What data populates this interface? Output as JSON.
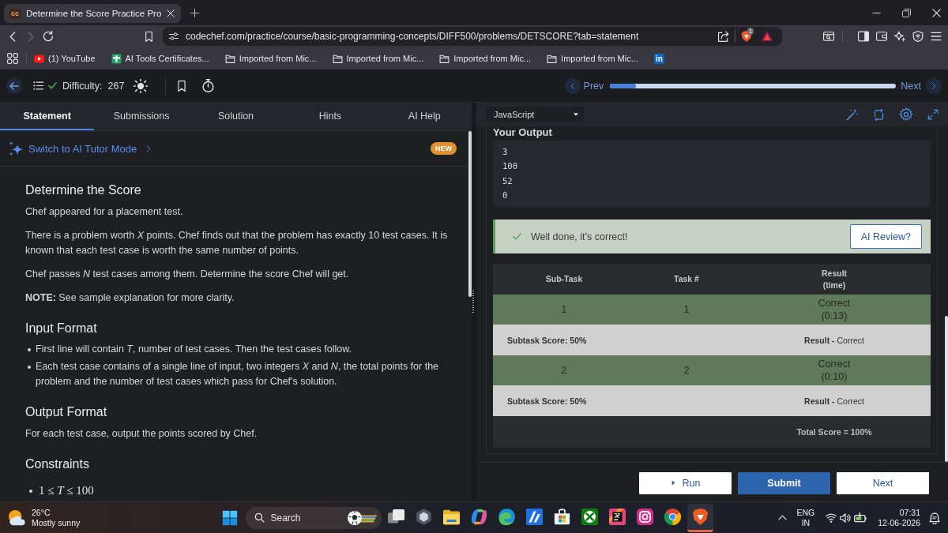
{
  "browser": {
    "tabs": [
      {
        "favicon": "cc",
        "title": "Determine the Score Practice Pro",
        "selected": true
      }
    ],
    "address": "codechef.com/practice/course/basic-programming-concepts/DIFF500/problems/DETSCORE?tab=statement",
    "shield_count": "1",
    "bookmarks": [
      {
        "kind": "youtube",
        "label": "(1) YouTube"
      },
      {
        "kind": "sheet",
        "label": "AI Tools Certificates..."
      },
      {
        "kind": "folder",
        "label": "Imported from Mic..."
      },
      {
        "kind": "folder",
        "label": "Imported from Mic..."
      },
      {
        "kind": "folder",
        "label": "Imported from Mic..."
      },
      {
        "kind": "folder",
        "label": "Imported from Mic..."
      },
      {
        "kind": "linkedin",
        "label": "in"
      }
    ]
  },
  "header": {
    "solved": true,
    "difficulty_label": "Difficulty:",
    "difficulty": "267",
    "prev": "Prev",
    "next": "Next",
    "progress": {
      "level": 0.09
    }
  },
  "left": {
    "tabs": [
      {
        "label": "Statement",
        "selected": true
      },
      {
        "label": "Submissions",
        "selected": false
      },
      {
        "label": "Solution",
        "selected": false
      },
      {
        "label": "Hints",
        "selected": false
      },
      {
        "label": "AI Help",
        "selected": false
      }
    ],
    "tutor": {
      "label": "Switch to AI Tutor Mode",
      "badge": "NEW"
    },
    "problem": {
      "title": "Determine the Score",
      "paragraphs": [
        "Chef appeared for a placement test.",
        "There is a problem worth *X* points. Chef finds out that the problem has exactly 10 test cases. It is known that each test case is worth the same number of points.",
        "Chef passes *N* test cases among them. Determine the score Chef will get.",
        "**NOTE:** See sample explanation for more clarity."
      ],
      "sections": [
        {
          "heading": "Input Format",
          "kind": "bullets",
          "items": [
            "First line will contain *T*, number of test cases. Then the test cases follow.",
            "Each test case contains of a single line of input, two integers *X* and *N*, the total points for the problem and the number of test cases which pass for Chef's solution."
          ]
        },
        {
          "heading": "Output Format",
          "kind": "text",
          "items": [
            "For each test case, output the points scored by Chef."
          ]
        },
        {
          "heading": "Constraints",
          "kind": "math",
          "items": [
            "1 ≤ *T* ≤ 100"
          ]
        }
      ]
    }
  },
  "editor": {
    "language": "JavaScript",
    "output_title": "Your Output",
    "output_lines": [
      "3",
      "100",
      "52",
      "0"
    ],
    "verdict": {
      "passed": true,
      "text": "Well done, it’s correct!",
      "review_button": "AI Review?"
    },
    "results": {
      "columns": [
        {
          "label": "Sub-Task"
        },
        {
          "label": "Task #"
        },
        {
          "label": "Result",
          "sub": "(time)"
        }
      ],
      "rows": [
        {
          "kind": "task",
          "subtask": "1",
          "task": "1",
          "result": "Correct",
          "time": "(0.13)",
          "passed": true
        },
        {
          "kind": "summary",
          "score": "Subtask Score: 50%",
          "result": "**Result -** Correct"
        },
        {
          "kind": "task",
          "subtask": "2",
          "task": "2",
          "result": "Correct",
          "time": "(0.10)",
          "passed": true
        },
        {
          "kind": "summary",
          "score": "Subtask Score: 50%",
          "result": "**Result -** Correct"
        }
      ],
      "total": "Total Score = 100%"
    },
    "buttons": [
      {
        "kind": "run",
        "label": "Run"
      },
      {
        "kind": "submit",
        "label": "Submit"
      },
      {
        "kind": "next",
        "label": "Next"
      }
    ]
  },
  "taskbar": {
    "weather": {
      "temp": "26°C",
      "condition": "Mostly sunny"
    },
    "search": {
      "placeholder": "Search"
    },
    "apps": [
      {
        "kind": "task-view",
        "active": false
      },
      {
        "kind": "hexagon",
        "active": false
      },
      {
        "kind": "explorer",
        "active": false
      },
      {
        "kind": "swirl",
        "active": false
      },
      {
        "kind": "wave",
        "active": false
      },
      {
        "kind": "slash-tile",
        "active": false
      },
      {
        "kind": "store",
        "active": false
      },
      {
        "kind": "x-tile",
        "active": false
      },
      {
        "kind": "code-tile",
        "active": false
      },
      {
        "kind": "camera",
        "active": false
      },
      {
        "kind": "chrome",
        "active": false
      },
      {
        "kind": "lion",
        "active": true
      }
    ],
    "tray": {
      "language": "ENG",
      "region": "IN",
      "time": "07:31",
      "date": "12-06-2026"
    }
  }
}
